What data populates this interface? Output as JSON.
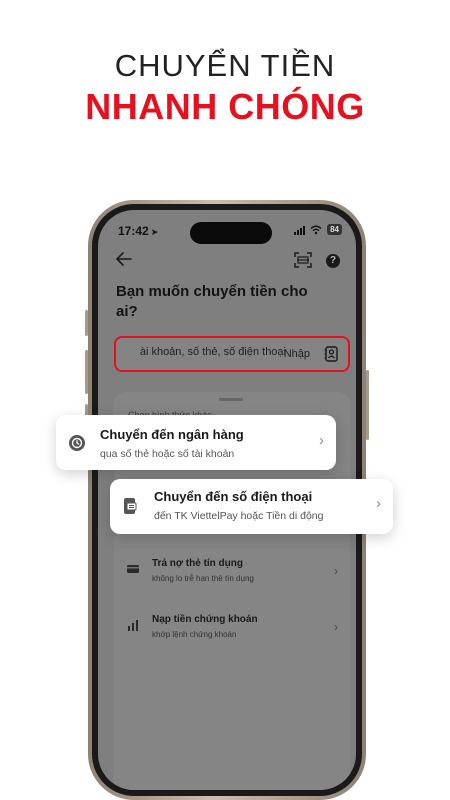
{
  "hero": {
    "line1": "CHUYỂN TIỀN",
    "line2": "NHANH CHÓNG"
  },
  "status_bar": {
    "time": "17:42",
    "battery": "84"
  },
  "screen": {
    "title": "Bạn muốn chuyển tiền cho ai?",
    "search": {
      "value": "ài khoản, số thẻ, số điện thoại",
      "action_label": "Nhập"
    },
    "sheet": {
      "section_label": "Chọn hình thức khác",
      "options": [
        {
          "title": "Trả nợ thẻ tín dụng",
          "subtitle": "không lo trễ hạn thẻ tín dụng",
          "icon": "credit-card-icon"
        },
        {
          "title": "Nạp tiền chứng khoán",
          "subtitle": "khớp lệnh chứng khoán",
          "icon": "stock-chart-icon"
        }
      ]
    }
  },
  "cards": [
    {
      "title": "Chuyển đến ngân hàng",
      "subtitle": "qua số thẻ hoặc số tài khoản",
      "icon": "bank-transfer-icon"
    },
    {
      "title": "Chuyển đến số điện thoại",
      "subtitle": "đến TK ViettelPay hoặc Tiền di động",
      "icon": "phone-transfer-icon"
    }
  ],
  "colors": {
    "accent_red": "#e5111f",
    "title_dark": "#222222",
    "screen_overlay": "#7f7f7f"
  }
}
